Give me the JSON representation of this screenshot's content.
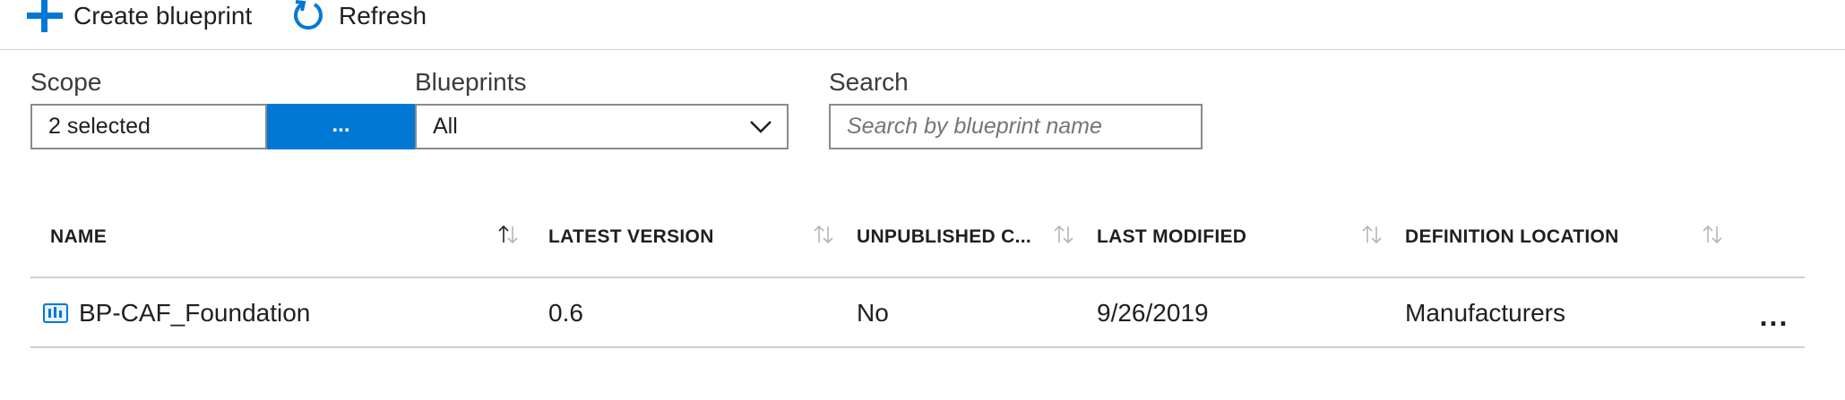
{
  "toolbar": {
    "create_label": "Create blueprint",
    "refresh_label": "Refresh"
  },
  "filters": {
    "scope_label": "Scope",
    "scope_value": "2 selected",
    "scope_button_label": "...",
    "blueprints_label": "Blueprints",
    "blueprints_value": "All",
    "search_label": "Search",
    "search_placeholder": "Search by blueprint name",
    "search_value": ""
  },
  "table": {
    "columns": [
      {
        "label": "NAME",
        "sort": "ascending"
      },
      {
        "label": "LATEST VERSION",
        "sort": "none"
      },
      {
        "label": "UNPUBLISHED C...",
        "sort": "none"
      },
      {
        "label": "LAST MODIFIED",
        "sort": "none"
      },
      {
        "label": "DEFINITION LOCATION",
        "sort": "none"
      }
    ],
    "rows": [
      {
        "icon": "blueprint-icon",
        "name": "BP-CAF_Foundation",
        "latest_version": "0.6",
        "unpublished": "No",
        "last_modified": "9/26/2019",
        "definition_location": "Manufacturers",
        "more_label": "..."
      }
    ]
  },
  "colors": {
    "accent": "#0078d4",
    "border": "#8a8a8a",
    "divider": "#cfcfcf",
    "sort_inactive": "#b5b5b5"
  }
}
